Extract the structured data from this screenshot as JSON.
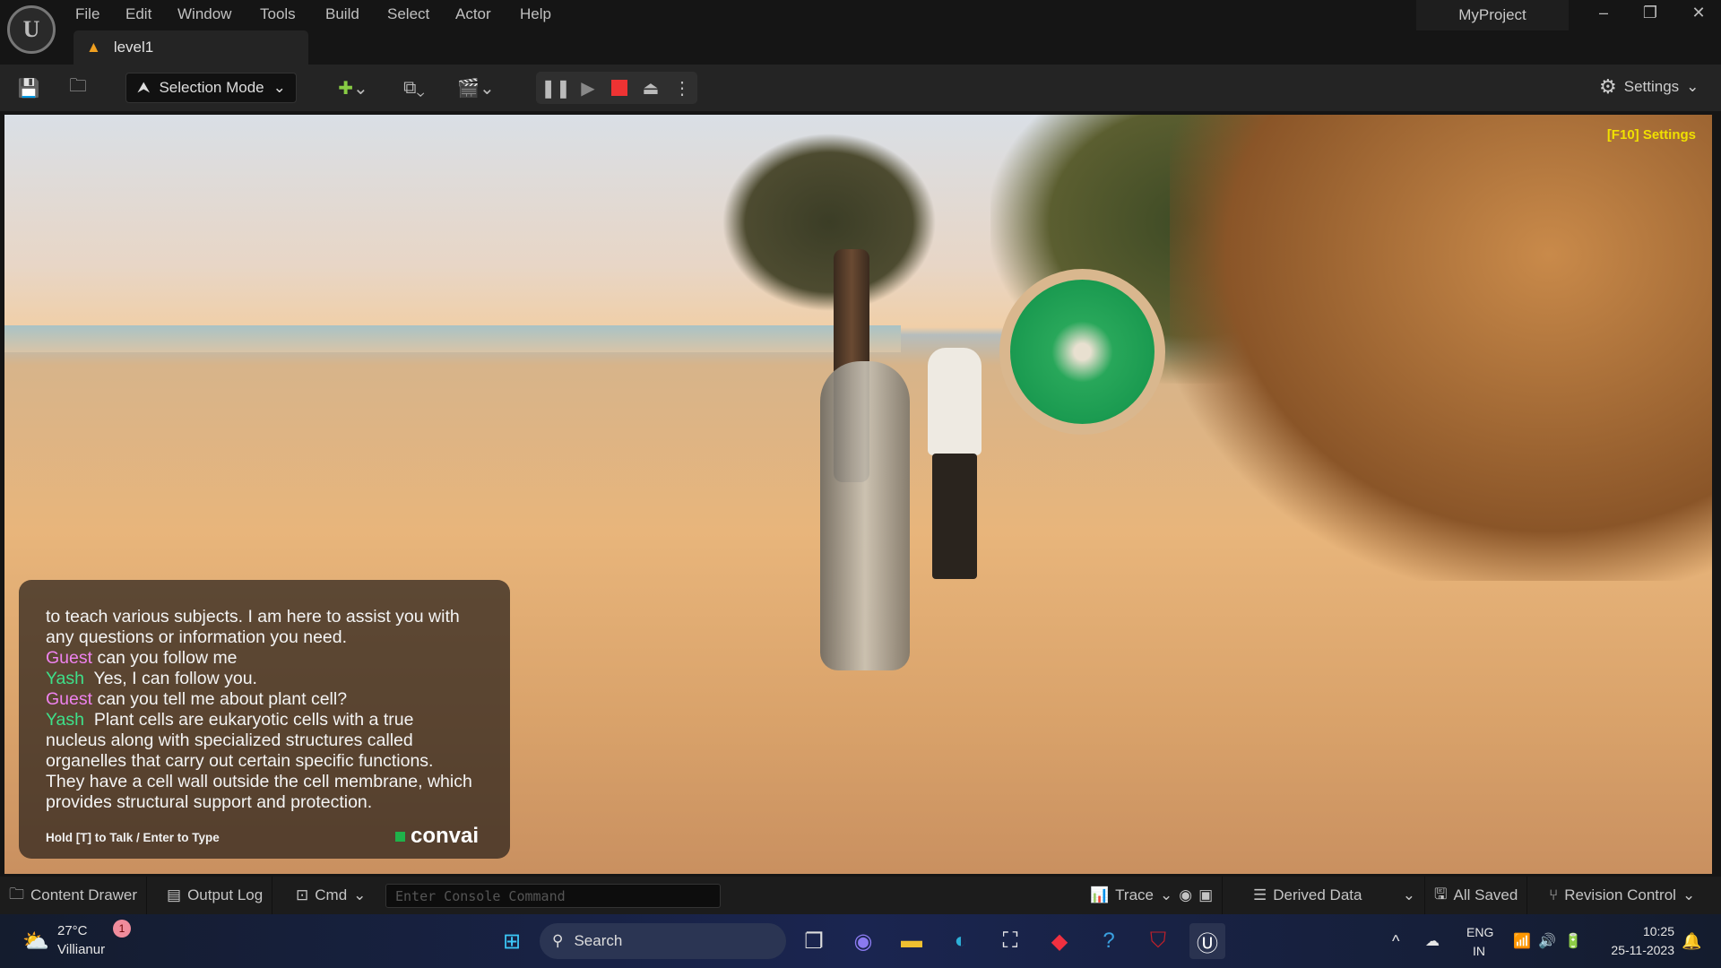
{
  "title_bar": {
    "menus": [
      "File",
      "Edit",
      "Window",
      "Tools",
      "Build",
      "Select",
      "Actor",
      "Help"
    ],
    "tab": "level1",
    "project": "MyProject"
  },
  "toolbar": {
    "selection_mode": "Selection Mode",
    "settings": "Settings"
  },
  "viewport": {
    "settings_hint": "[F10] Settings"
  },
  "chat": {
    "lines": [
      {
        "speaker": "",
        "text": "to teach various subjects.  I am here to assist you with"
      },
      {
        "speaker": "",
        "text": "any questions or information you need."
      },
      {
        "speaker": "Guest",
        "text": "can you follow me"
      },
      {
        "speaker": "Yash",
        "text": "Yes, I can follow you."
      },
      {
        "speaker": "Guest",
        "text": "can you tell me about plant cell?"
      },
      {
        "speaker": "Yash",
        "text": "Plant cells are eukaryotic cells with a true"
      },
      {
        "speaker": "",
        "text": "nucleus along with specialized structures called"
      },
      {
        "speaker": "",
        "text": "organelles that carry out certain specific functions."
      },
      {
        "speaker": "",
        "text": "They have a cell wall outside the cell membrane, which"
      },
      {
        "speaker": "",
        "text": "provides structural support and protection."
      }
    ],
    "hint": "Hold [T] to Talk / Enter to Type",
    "brand": "convai",
    "colors": {
      "guest": "#ee82ee",
      "yash": "#3ee08a"
    }
  },
  "status_bar": {
    "content_drawer": "Content Drawer",
    "output_log": "Output Log",
    "cmd": "Cmd",
    "console_placeholder": "Enter Console Command",
    "trace": "Trace",
    "derived_data": "Derived Data",
    "all_saved": "All Saved",
    "revision_control": "Revision Control"
  },
  "taskbar": {
    "temp": "27°C",
    "location": "Villianur",
    "badge": "1",
    "search": "Search",
    "lang1": "ENG",
    "lang2": "IN",
    "time": "10:25",
    "date": "25-11-2023"
  }
}
